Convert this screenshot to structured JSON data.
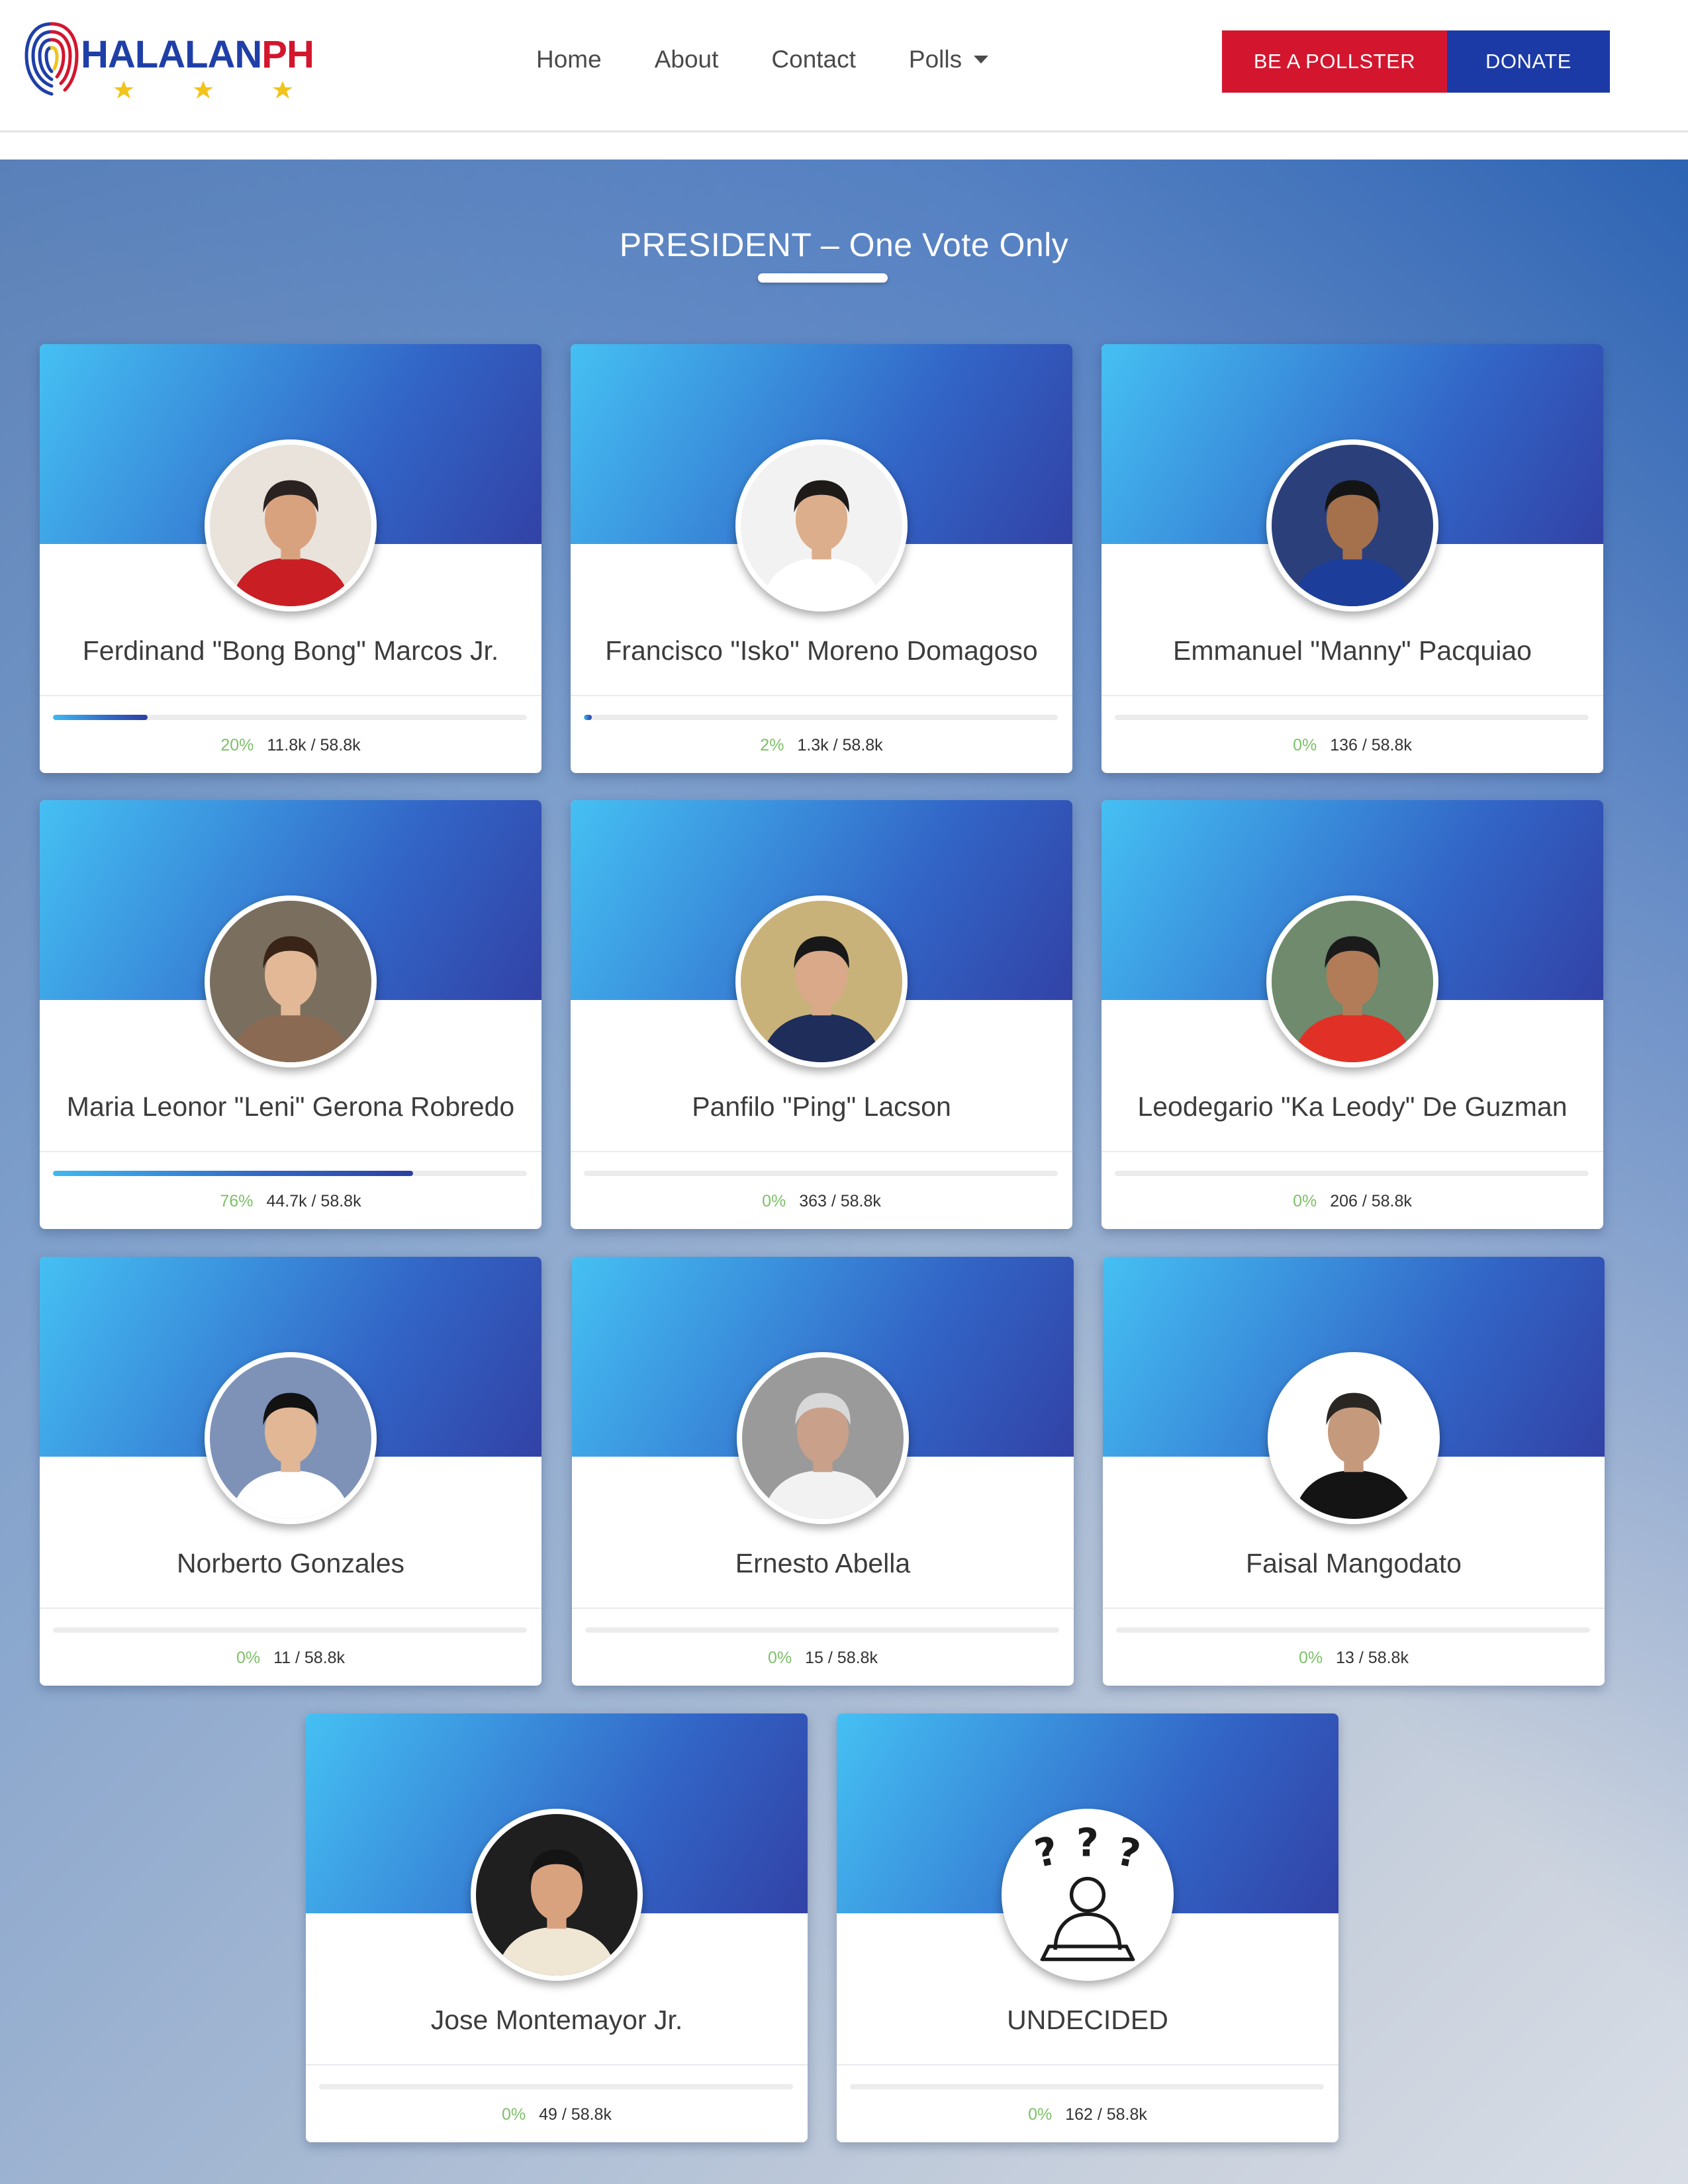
{
  "brand": {
    "name_part1": "HALALAN",
    "name_part2": "PH",
    "colors": {
      "blue": "#1f3fa8",
      "red": "#d3162e",
      "star": "#f2c31a"
    }
  },
  "nav": [
    {
      "label": "Home"
    },
    {
      "label": "About"
    },
    {
      "label": "Contact"
    },
    {
      "label": "Polls",
      "icon": "caret-down-icon"
    }
  ],
  "buttons": {
    "pollster": "BE A POLLSTER",
    "donate": "DONATE"
  },
  "section": {
    "title": "PRESIDENT – One Vote Only"
  },
  "colors": {
    "accent_green": "#7dc068",
    "card_gradient_start": "#45c0f3",
    "card_gradient_end": "#3242a6",
    "pollster_red": "#d3162e",
    "donate_blue": "#1c3aa6"
  },
  "candidates": [
    {
      "name": "Ferdinand \"Bong Bong\" Marcos Jr.",
      "percent": "20%",
      "votes": "11.8k / 58.8k",
      "fill": 20,
      "photo": "candidate-photo"
    },
    {
      "name": "Francisco \"Isko\" Moreno Domagoso",
      "percent": "2%",
      "votes": "1.3k / 58.8k",
      "fill": 2,
      "photo": "candidate-photo"
    },
    {
      "name": "Emmanuel \"Manny\" Pacquiao",
      "percent": "0%",
      "votes": "136 / 58.8k",
      "fill": 0,
      "photo": "candidate-photo"
    },
    {
      "name": "Maria Leonor \"Leni\" Gerona Robredo",
      "percent": "76%",
      "votes": "44.7k / 58.8k",
      "fill": 76,
      "photo": "candidate-photo"
    },
    {
      "name": "Panfilo \"Ping\" Lacson",
      "percent": "0%",
      "votes": "363 / 58.8k",
      "fill": 0,
      "photo": "candidate-photo"
    },
    {
      "name": "Leodegario \"Ka Leody\" De Guzman",
      "percent": "0%",
      "votes": "206 / 58.8k",
      "fill": 0,
      "photo": "candidate-photo"
    },
    {
      "name": "Norberto Gonzales",
      "percent": "0%",
      "votes": "11 / 58.8k",
      "fill": 0,
      "photo": "candidate-photo"
    },
    {
      "name": "Ernesto Abella",
      "percent": "0%",
      "votes": "15 / 58.8k",
      "fill": 0,
      "photo": "candidate-photo"
    },
    {
      "name": "Faisal Mangodato",
      "percent": "0%",
      "votes": "13 / 58.8k",
      "fill": 0,
      "photo": "candidate-photo"
    },
    {
      "name": "Jose Montemayor Jr.",
      "percent": "0%",
      "votes": "49 / 58.8k",
      "fill": 0,
      "photo": "candidate-photo"
    },
    {
      "name": "UNDECIDED",
      "percent": "0%",
      "votes": "162 / 58.8k",
      "fill": 0,
      "photo": "undecided-icon"
    }
  ]
}
